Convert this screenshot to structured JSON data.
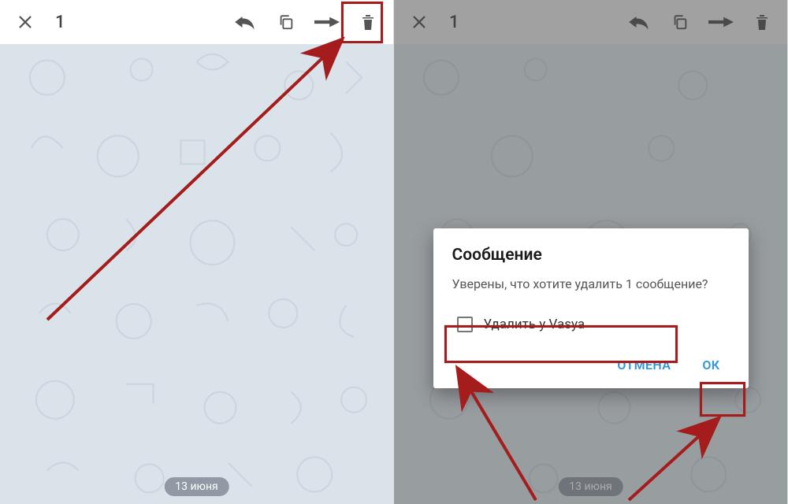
{
  "left": {
    "selection_count": "1",
    "date_label": "13 июня"
  },
  "right": {
    "selection_count": "1",
    "date_label": "13 июня"
  },
  "dialog": {
    "title": "Сообщение",
    "body": "Уверены, что хотите удалить 1 сообщение?",
    "checkbox_label": "Удалить у Vasya",
    "cancel": "ОТМЕНА",
    "ok": "ОК"
  },
  "colors": {
    "highlight": "#a41c1c",
    "accent": "#2e96d6"
  }
}
